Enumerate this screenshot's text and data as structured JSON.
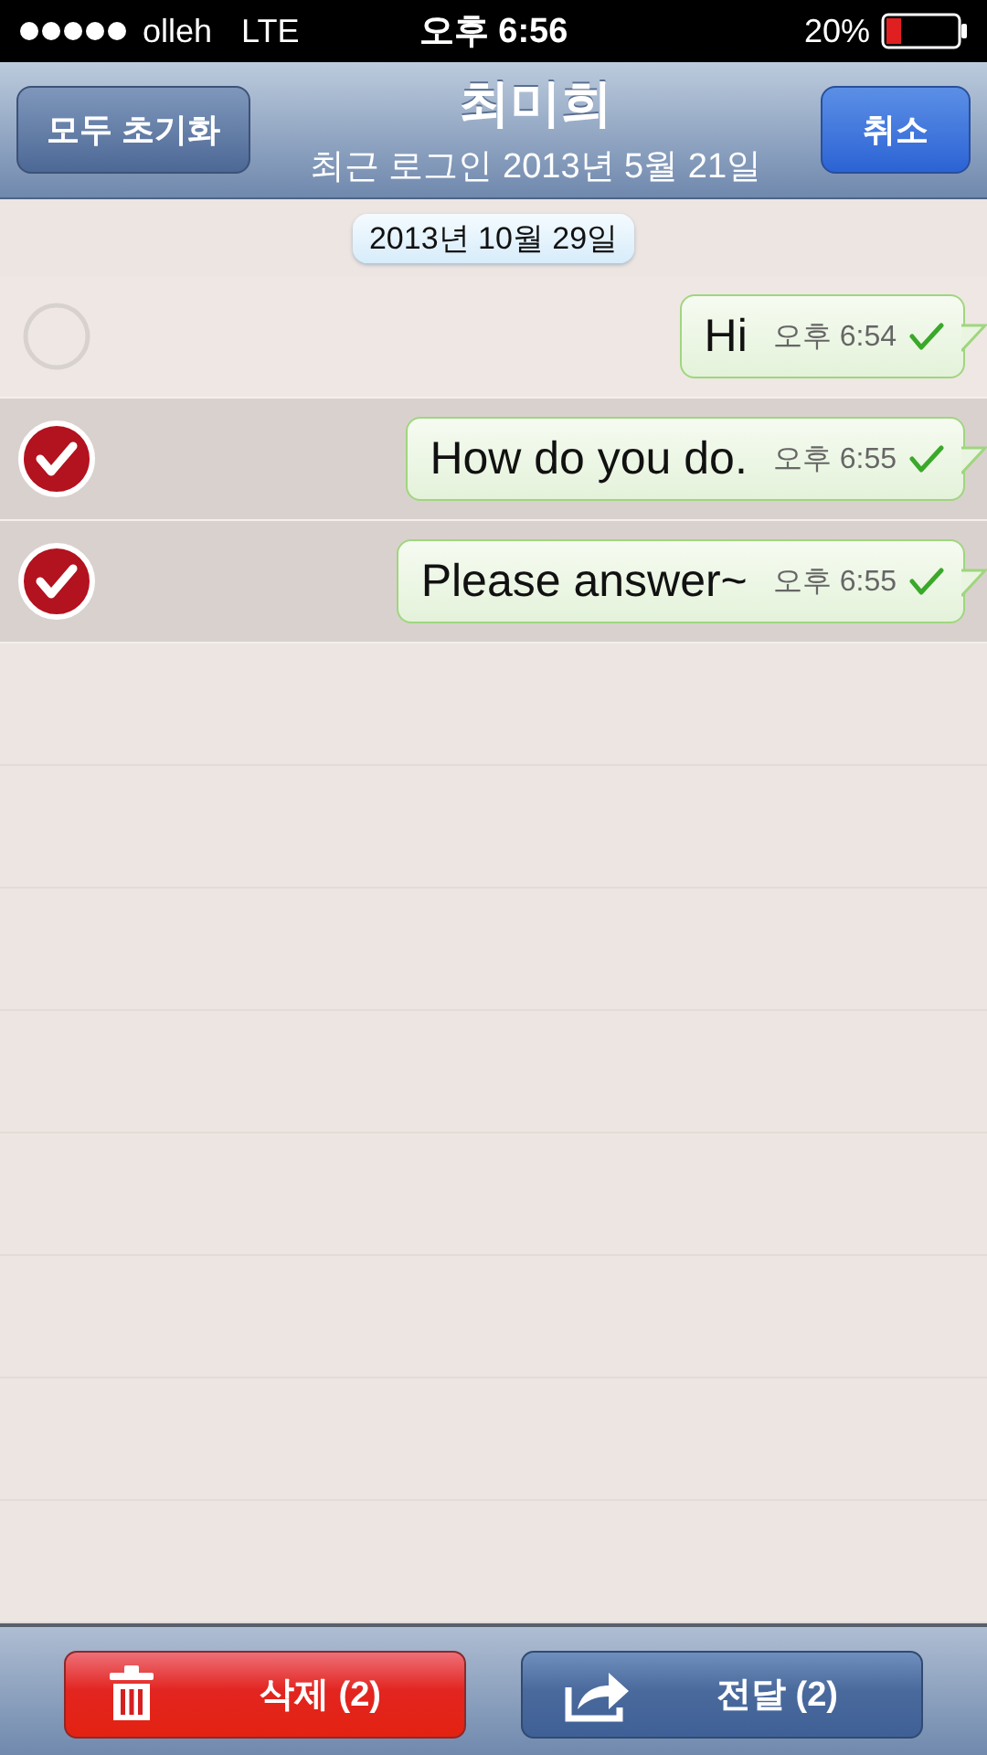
{
  "status_bar": {
    "carrier": "olleh",
    "network": "LTE",
    "time": "오후 6:56",
    "battery": "20%"
  },
  "nav_bar": {
    "left_button": "모두 초기화",
    "title": "최미희",
    "subtitle": "최근 로그인 2013년 5월 21일",
    "right_button": "취소"
  },
  "date_chip": "2013년 10월 29일",
  "messages": [
    {
      "text": "Hi",
      "time": "오후 6:54",
      "selected": false
    },
    {
      "text": "How do you do.",
      "time": "오후 6:55",
      "selected": true
    },
    {
      "text": "Please answer~",
      "time": "오후 6:55",
      "selected": true
    }
  ],
  "toolbar": [
    {
      "kind": "delete",
      "label": "삭제 (2)"
    },
    {
      "kind": "forward",
      "label": "전달 (2)"
    }
  ]
}
